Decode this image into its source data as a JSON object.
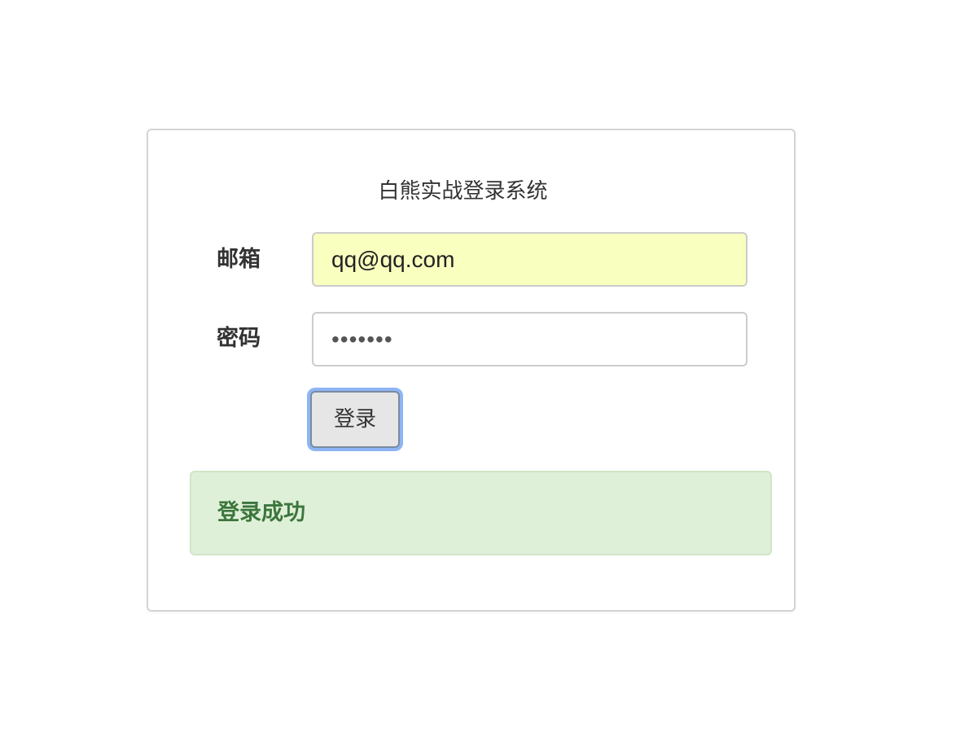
{
  "login_form": {
    "title": "白熊实战登录系统",
    "email_label": "邮箱",
    "email_value": "qq@qq.com",
    "password_label": "密码",
    "password_value": "•••••••",
    "submit_label": "登录"
  },
  "alert": {
    "message": "登录成功",
    "type": "success"
  },
  "colors": {
    "autofill_background": "#f9ffbf",
    "success_background": "#dff0d8",
    "success_text": "#3c763d",
    "focus_ring": "#8db5f5"
  }
}
